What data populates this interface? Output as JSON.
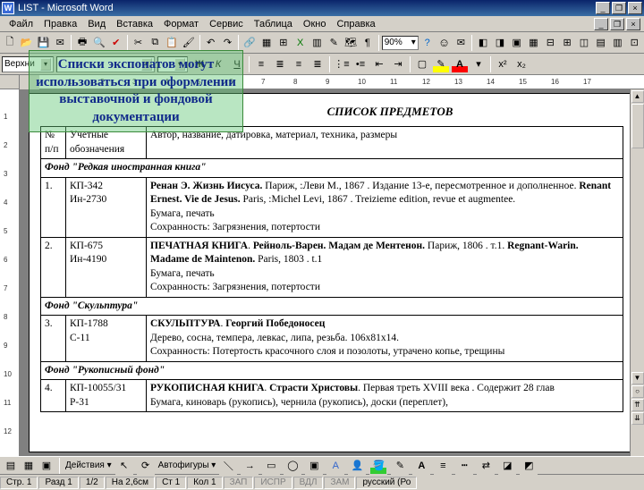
{
  "title": "LIST - Microsoft Word",
  "menu": [
    "Файл",
    "Правка",
    "Вид",
    "Вставка",
    "Формат",
    "Сервис",
    "Таблица",
    "Окно",
    "Справка"
  ],
  "zoom": "90%",
  "style_combo": "Верхни",
  "overlay": "Списки экспонатов могут использоваться при оформлении выставочной и фондовой документации",
  "doc_title": "СПИСОК ПРЕДМЕТОВ",
  "hdr": {
    "c1": "№ п/п",
    "c2": "Учетные обозначения",
    "c3": "Автор, название, датировка, материал, техника, размеры"
  },
  "fond1": "Фонд \"Редкая иностранная книга\"",
  "fond2": "Фонд \"Скульптура\"",
  "fond3": "Фонд \"Рукописный фонд\"",
  "rows": {
    "r1": {
      "n": "1.",
      "code": "КП-342\nИн-2730",
      "desc": "<b>Ренан Э. Жизнь Иисуса.</b> Париж, :Леви М., 1867 . Издание 13-е, пересмотренное и дополненное. <b>Renant Ernest. Vie de Jesus.</b> Paris, :Michel Levi, 1867 . Treizieme edition, revue et augmentee.\nБумага, печать\nСохранность: Загрязнения, потертости"
    },
    "r2": {
      "n": "2.",
      "code": "КП-675\nИн-4190",
      "desc": "<b>ПЕЧАТНАЯ КНИГА</b>. <b>Рейноль-Варен. Мадам де Ментенон.</b> Париж, 1806 . т.1. <b>Regnant-Warin. Madame de Maintenon.</b> Paris, 1803 . t.1\nБумага, печать\nСохранность: Загрязнения, потертости"
    },
    "r3": {
      "n": "3.",
      "code": "КП-1788\nС-11",
      "desc": "<b>СКУЛЬПТУРА</b>. <b>Георгий Победоносец</b>\nДерево, сосна, темпера, левкас, липа, резьба. 106х81х14.\nСохранность: Потертость красочного слоя и позолоты, утрачено копье, трещины"
    },
    "r4": {
      "n": "4.",
      "code": "КП-10055/31\nР-31",
      "desc": "<b>РУКОПИСНАЯ КНИГА</b>. <b>Страсти Христовы</b>. Первая треть XVIII века . Содержит 28 глав\nБумага, киноварь (рукопись), чернила (рукопись), доски (переплет),"
    }
  },
  "drawbar": {
    "actions": "Действия",
    "autoshapes": "Автофигуры"
  },
  "status": {
    "page": "Стр. 1",
    "sect": "Разд 1",
    "pages": "1/2",
    "at": "На 2,6см",
    "line": "Ст 1",
    "col": "Кол 1",
    "rec": "ЗАП",
    "trk": "ИСПР",
    "ext": "ВДЛ",
    "ovr": "ЗАМ",
    "lang": "русский (Ро"
  }
}
